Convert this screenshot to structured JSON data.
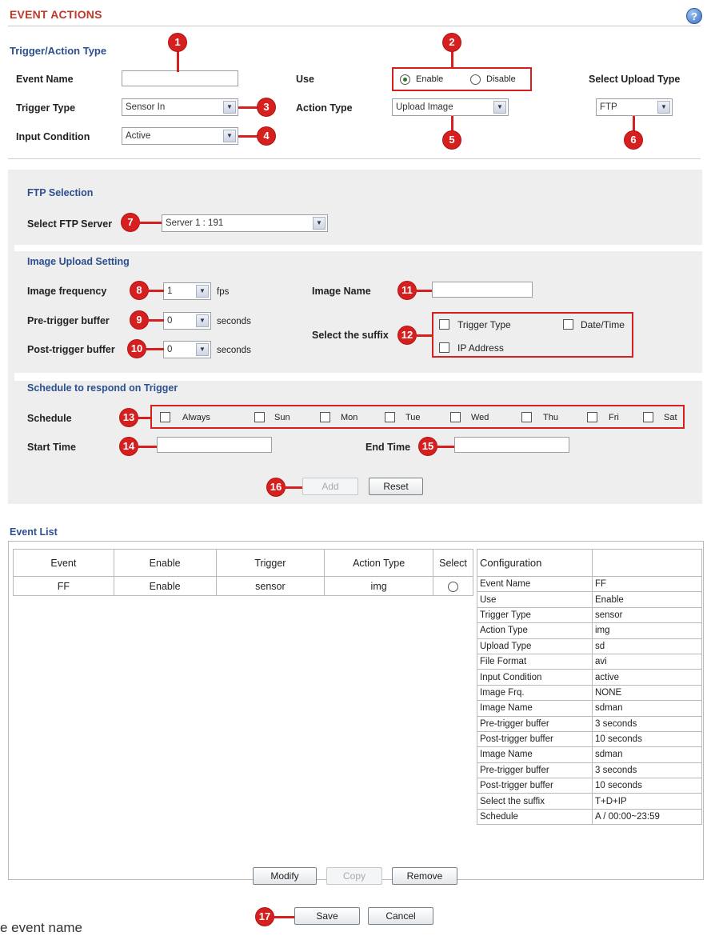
{
  "header": {
    "title": "EVENT ACTIONS",
    "help_icon": "?"
  },
  "trigger_section": {
    "title": "Trigger/Action Type",
    "event_name_label": "Event Name",
    "event_name_value": "",
    "use_label": "Use",
    "use_enable": "Enable",
    "use_disable": "Disable",
    "use_selected": "Enable",
    "upload_type_label": "Select Upload Type",
    "upload_type_value": "FTP",
    "trigger_type_label": "Trigger Type",
    "trigger_type_value": "Sensor In",
    "action_type_label": "Action Type",
    "action_type_value": "Upload Image",
    "input_condition_label": "Input Condition",
    "input_condition_value": "Active"
  },
  "ftp_section": {
    "title": "FTP Selection",
    "server_label": "Select FTP Server",
    "server_value": "Server 1 : 191"
  },
  "image_upload": {
    "title": "Image Upload Setting",
    "frequency_label": "Image frequency",
    "frequency_value": "1",
    "frequency_unit": "fps",
    "pre_buffer_label": "Pre-trigger buffer",
    "pre_buffer_value": "0",
    "post_buffer_label": "Post-trigger buffer",
    "post_buffer_value": "0",
    "seconds_unit": "seconds",
    "image_name_label": "Image Name",
    "image_name_value": "",
    "suffix_label": "Select the suffix",
    "suffix_trigger": "Trigger Type",
    "suffix_datetime": "Date/Time",
    "suffix_ip": "IP Address"
  },
  "schedule_section": {
    "title": "Schedule to respond on Trigger",
    "schedule_label": "Schedule",
    "days": [
      "Always",
      "Sun",
      "Mon",
      "Tue",
      "Wed",
      "Thu",
      "Fri",
      "Sat"
    ],
    "start_label": "Start Time",
    "end_label": "End Time",
    "start_value": "",
    "end_value": ""
  },
  "form_buttons": {
    "add": "Add",
    "reset": "Reset"
  },
  "callouts": [
    "1",
    "2",
    "3",
    "4",
    "5",
    "6",
    "7",
    "8",
    "9",
    "10",
    "11",
    "12",
    "13",
    "14",
    "15",
    "16",
    "17"
  ],
  "event_list": {
    "title": "Event List",
    "columns": [
      "Event",
      "Enable",
      "Trigger",
      "Action Type",
      "Select"
    ],
    "rows": [
      {
        "event": "FF",
        "enable": "Enable",
        "trigger": "sensor",
        "action": "img"
      }
    ]
  },
  "configuration": {
    "header": "Configuration",
    "rows": [
      [
        "Event Name",
        "FF"
      ],
      [
        "Use",
        "Enable"
      ],
      [
        "Trigger Type",
        "sensor"
      ],
      [
        "Action Type",
        "img"
      ],
      [
        "Upload Type",
        "sd"
      ],
      [
        "File Format",
        "avi"
      ],
      [
        "Input Condition",
        "active"
      ],
      [
        "Image Frq.",
        "NONE"
      ],
      [
        "Image Name",
        "sdman"
      ],
      [
        "Pre-trigger buffer",
        "3 seconds"
      ],
      [
        "Post-trigger buffer",
        "10 seconds"
      ],
      [
        "Image Name",
        "sdman"
      ],
      [
        "Pre-trigger buffer",
        "3 seconds"
      ],
      [
        "Post-trigger buffer",
        "10 seconds"
      ],
      [
        "Select the suffix",
        "T+D+IP"
      ],
      [
        "Schedule",
        "A / 00:00~23:59"
      ]
    ]
  },
  "list_buttons": {
    "modify": "Modify",
    "copy": "Copy",
    "remove": "Remove"
  },
  "bottom_buttons": {
    "save": "Save",
    "cancel": "Cancel"
  },
  "caption": "e event name"
}
